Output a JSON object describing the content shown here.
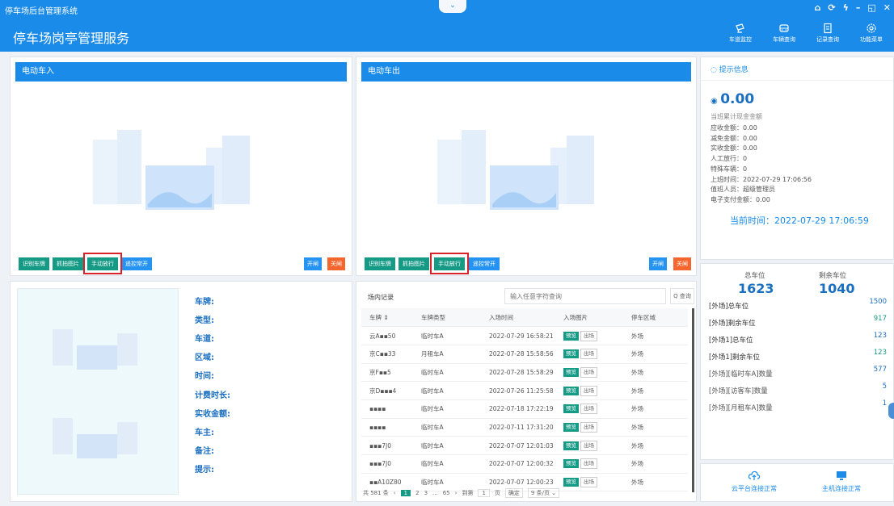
{
  "window": {
    "app_title": "停车场后台管理系统",
    "collapse_glyph": "⌄",
    "controls": [
      "⌂",
      "⟳",
      "ϟ",
      "–",
      "◱",
      "✕"
    ]
  },
  "header": {
    "title": "停车场岗亭管理服务",
    "tools": [
      {
        "icon": "lane-monitor-icon",
        "label": "车道监控"
      },
      {
        "icon": "vehicle-query-icon",
        "label": "车辆查询"
      },
      {
        "icon": "record-query-icon",
        "label": "记录查询"
      },
      {
        "icon": "gear-icon",
        "label": "功能菜单"
      }
    ]
  },
  "entry_cam": {
    "title": "电动车入",
    "buttons": {
      "recognize": "识别车牌",
      "capture": "抓拍图片",
      "manual": "手动放行",
      "remote": "遥控常开",
      "open": "开闸",
      "close": "关闸"
    }
  },
  "exit_cam": {
    "title": "电动车出",
    "buttons": {
      "recognize": "识别车牌",
      "capture": "抓拍图片",
      "manual": "手动放行",
      "remote": "遥控常开",
      "open": "开闸",
      "close": "关闸"
    }
  },
  "detail": {
    "fields": [
      "车牌:",
      "类型:",
      "车道:",
      "区域:",
      "时间:",
      "计费时长:",
      "实收金额:",
      "车主:",
      "备注:",
      "提示:"
    ]
  },
  "records": {
    "title": "场内记录",
    "search_placeholder": "输入任意字符查询",
    "search_button": "Q 查询",
    "columns": [
      "车牌 ⇕",
      "车牌类型",
      "入场时间",
      "入场图片",
      "停车区域"
    ],
    "preview_label": "预览",
    "exit_label": "出场",
    "rows": [
      {
        "plate": "云A▪▪50",
        "type": "临时车A",
        "time": "2022-07-29 16:58:21",
        "area": "外场"
      },
      {
        "plate": "京C▪▪33",
        "type": "月租车A",
        "time": "2022-07-28 15:58:56",
        "area": "外场"
      },
      {
        "plate": "京F▪▪5",
        "type": "临时车A",
        "time": "2022-07-28 15:58:29",
        "area": "外场"
      },
      {
        "plate": "京D▪▪▪4",
        "type": "临时车A",
        "time": "2022-07-26 11:25:58",
        "area": "外场"
      },
      {
        "plate": "▪▪▪▪",
        "type": "临时车A",
        "time": "2022-07-18 17:22:19",
        "area": "外场"
      },
      {
        "plate": "▪▪▪▪",
        "type": "临时车A",
        "time": "2022-07-11 17:31:20",
        "area": "外场"
      },
      {
        "plate": "▪▪▪7J0",
        "type": "临时车A",
        "time": "2022-07-07 12:01:03",
        "area": "外场"
      },
      {
        "plate": "▪▪▪7J0",
        "type": "临时车A",
        "time": "2022-07-07 12:00:32",
        "area": "外场"
      },
      {
        "plate": "▪▪A10Z80",
        "type": "临时车A",
        "time": "2022-07-07 12:00:23",
        "area": "外场"
      }
    ],
    "pager": {
      "total": "共 581 条",
      "pages": [
        "1",
        "2",
        "3",
        "...",
        "65"
      ],
      "goto_label": "到第",
      "goto_value": "1",
      "page_unit": "页",
      "confirm": "确定",
      "page_size": "9 条/页 ⌄"
    }
  },
  "info": {
    "title": "提示信息",
    "amount": "0.00",
    "amount_caption": "当班累计现金金额",
    "lines": [
      "应收金额：0.00",
      "减免金额：0.00",
      "实收金额：0.00",
      "人工放行：0",
      "特殊车辆：0",
      "上班时间：2022-07-29 17:06:56",
      "值班人员：超级管理员",
      "电子支付金额：0.00"
    ],
    "current_time": "当前时间：2022-07-29 17:06:59"
  },
  "parking": {
    "total_label": "总车位",
    "total_value": "1623",
    "remain_label": "剩余车位",
    "remain_value": "1040",
    "rows": [
      {
        "label": "[外场]总车位",
        "value": "1500"
      },
      {
        "label": "[外场]剩余车位",
        "value": "917"
      },
      {
        "label": "[外场1]总车位",
        "value": "123"
      },
      {
        "label": "[外场1]剩余车位",
        "value": "123"
      },
      {
        "label": "[外场][临时车A]数量",
        "value": "577"
      },
      {
        "label": "[外场][访客车]数量",
        "value": "5"
      },
      {
        "label": "[外场][月租车A]数量",
        "value": "1"
      }
    ]
  },
  "status": {
    "cloud": "云平台连接正常",
    "host": "主机连接正常"
  },
  "colors": {
    "primary": "#1a8be8",
    "green": "#159a86",
    "orange": "#f5662e",
    "highlight": "#d9232a"
  }
}
